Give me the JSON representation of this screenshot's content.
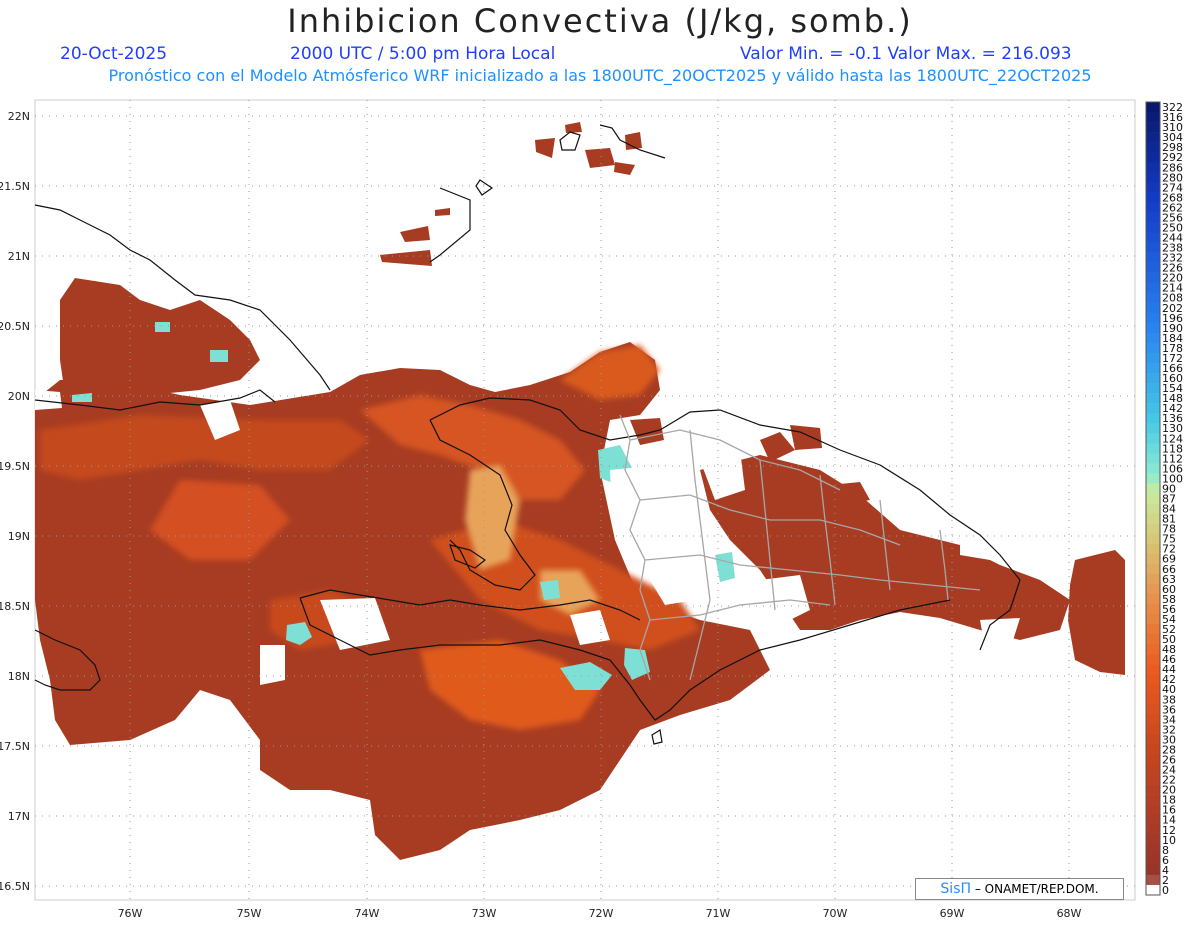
{
  "header": {
    "title": "Inhibicion Convectiva (J/kg, somb.)",
    "date": "20-Oct-2025",
    "time": "2000 UTC / 5:00 pm Hora Local",
    "minmax": "Valor Min. = -0.1  Valor Max. = 216.093",
    "description": "Pronóstico con el Modelo Atmósferico WRF inicializado a las 1800UTC_20OCT2025 y válido hasta las  1800UTC_22OCT2025"
  },
  "map": {
    "lat_labels": [
      "22N",
      "21.5N",
      "21N",
      "20.5N",
      "20N",
      "19.5N",
      "19N",
      "18.5N",
      "18N",
      "17.5N",
      "17N",
      "16.5N"
    ],
    "lon_labels": [
      "76W",
      "75W",
      "74W",
      "73W",
      "72W",
      "71W",
      "70W",
      "69W",
      "68W"
    ],
    "colors": {
      "field_dark": "#a23a22",
      "field_mid": "#c2461e",
      "field_bright": "#e0571a",
      "field_light": "#e7a45a",
      "field_cyan": "#7ee0d4",
      "coast": "#111111",
      "borders": "#a6a6a6"
    }
  },
  "colorbar": {
    "labels": [
      "322",
      "316",
      "310",
      "304",
      "298",
      "292",
      "286",
      "280",
      "274",
      "268",
      "262",
      "256",
      "250",
      "244",
      "238",
      "232",
      "226",
      "220",
      "214",
      "208",
      "202",
      "196",
      "190",
      "184",
      "178",
      "172",
      "166",
      "160",
      "154",
      "148",
      "142",
      "136",
      "130",
      "124",
      "118",
      "112",
      "106",
      "100",
      "90",
      "87",
      "84",
      "81",
      "78",
      "75",
      "72",
      "69",
      "66",
      "63",
      "60",
      "58",
      "56",
      "54",
      "52",
      "50",
      "48",
      "46",
      "44",
      "42",
      "40",
      "38",
      "36",
      "34",
      "32",
      "30",
      "28",
      "26",
      "24",
      "22",
      "20",
      "18",
      "16",
      "14",
      "12",
      "10",
      "8",
      "6",
      "4",
      "2",
      "0"
    ]
  },
  "credit": {
    "sis": "SisΠ",
    "text": "– ONAMET/REP.DOM."
  }
}
